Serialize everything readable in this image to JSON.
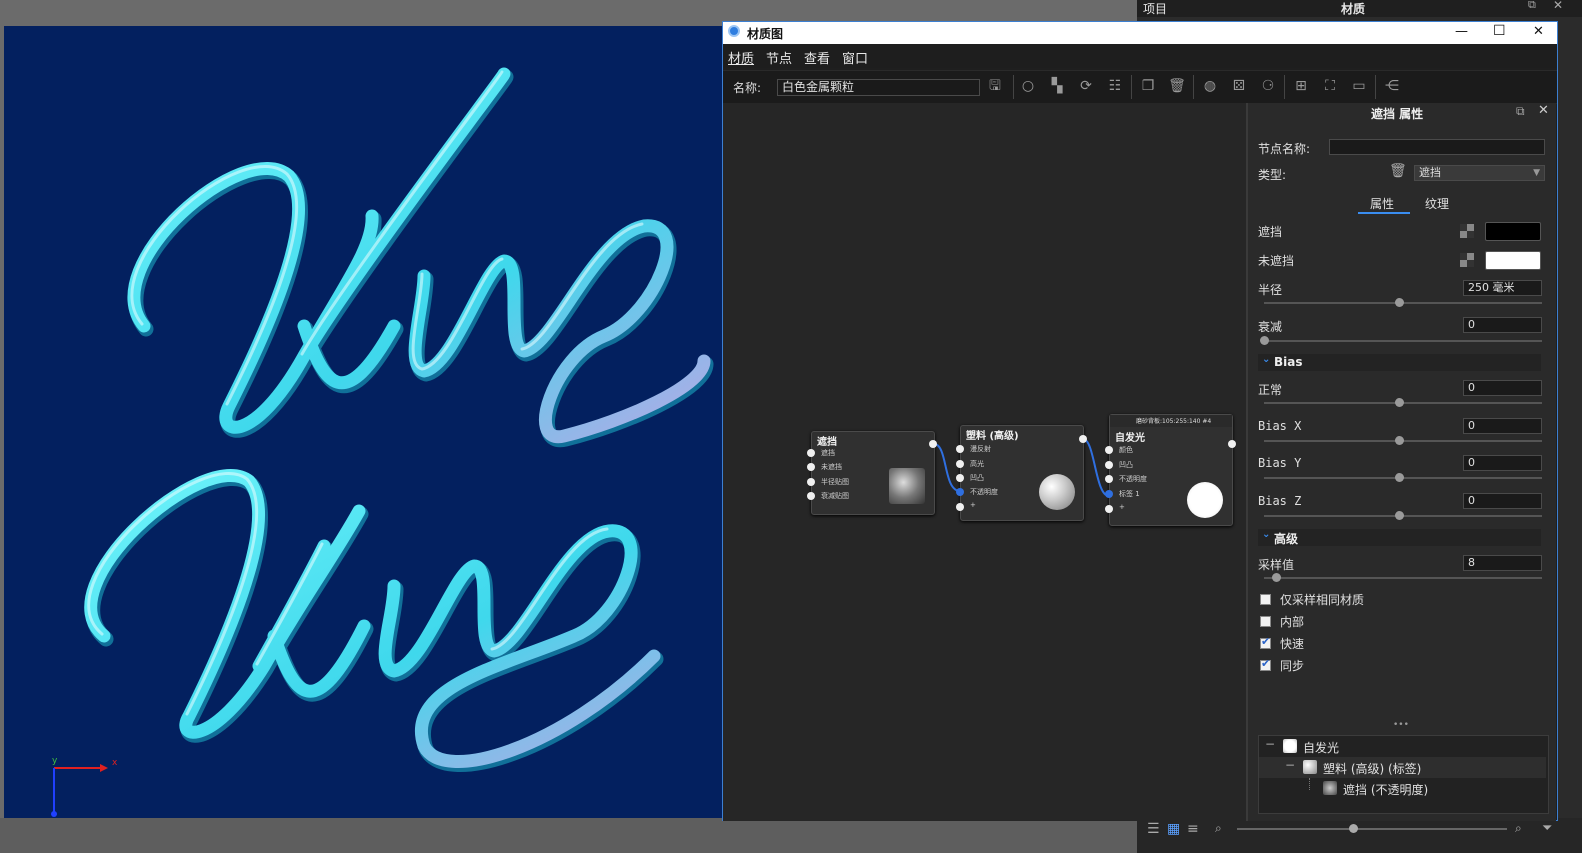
{
  "app": {
    "panel_title_left": "项目",
    "panel_title_center": "材质"
  },
  "viewport": {
    "text_line1": "Wing",
    "text_line2": "Wing",
    "axis_x": "x",
    "axis_y": "y",
    "background": "#03205f",
    "stroke_color": "#4de8f0"
  },
  "window": {
    "title": "材质图",
    "minimize": "—",
    "maximize": "☐",
    "close": "✕"
  },
  "menu": [
    "材质",
    "节点",
    "查看",
    "窗口"
  ],
  "toolbar": {
    "name_label": "名称:",
    "name_value": "白色金属颗粒"
  },
  "nodes": {
    "occlusion": {
      "title": "遮挡",
      "ports": [
        "遮挡",
        "未遮挡",
        "半径贴图",
        "衰减贴图"
      ]
    },
    "plastic": {
      "title": "塑料 (高级)",
      "ports": [
        "漫反射",
        "高光",
        "凹凸",
        "不透明度",
        "+"
      ]
    },
    "emissive": {
      "header": "磨砂背板:105:255:140 #4",
      "title": "自发光",
      "ports": [
        "颜色",
        "凹凸",
        "不透明度",
        "标签 1",
        "+"
      ]
    }
  },
  "properties": {
    "header": "遮挡 属性",
    "node_name_label": "节点名称:",
    "node_name_value": "",
    "type_label": "类型:",
    "type_value": "遮挡",
    "tabs": [
      "属性",
      "纹理"
    ],
    "occluded_label": "遮挡",
    "occluded_color": "#000000",
    "unoccluded_label": "未遮挡",
    "unoccluded_color": "#ffffff",
    "radius_label": "半径",
    "radius_value": "250 毫米",
    "falloff_label": "衰减",
    "falloff_value": "0",
    "bias_section": "Bias",
    "normal_label": "正常",
    "normal_value": "0",
    "biasx_label": "Bias X",
    "biasx_value": "0",
    "biasy_label": "Bias Y",
    "biasy_value": "0",
    "biasz_label": "Bias Z",
    "biasz_value": "0",
    "advanced_section": "高级",
    "samples_label": "采样值",
    "samples_value": "8",
    "checkboxes": [
      {
        "label": "仅采样相同材质",
        "checked": false
      },
      {
        "label": "内部",
        "checked": false
      },
      {
        "label": "快速",
        "checked": true
      },
      {
        "label": "同步",
        "checked": true
      }
    ],
    "tree": [
      {
        "label": "自发光"
      },
      {
        "label": "塑料 (高级) (标签)"
      },
      {
        "label": "遮挡 (不透明度)"
      }
    ],
    "tree_dots": "•••"
  }
}
